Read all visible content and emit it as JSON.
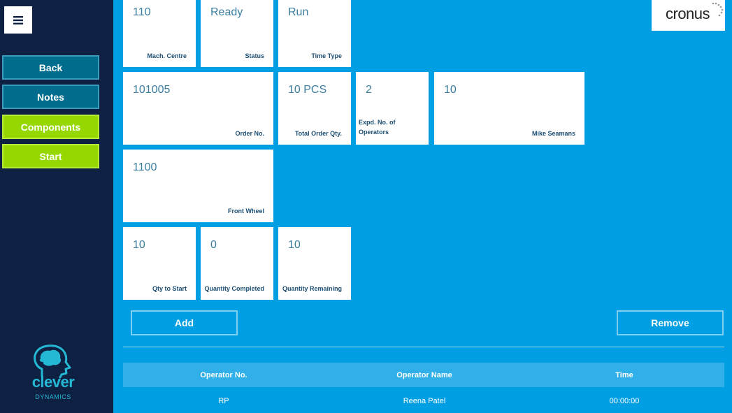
{
  "sidebar": {
    "menu_icon": "hamburger-icon",
    "buttons": [
      {
        "label": "Back",
        "style": "teal"
      },
      {
        "label": "Notes",
        "style": "teal"
      },
      {
        "label": "Components",
        "style": "green"
      },
      {
        "label": "Start",
        "style": "green"
      }
    ],
    "logo": {
      "name": "clever",
      "sub": "DYNAMICS"
    }
  },
  "brand": {
    "name": "cronus"
  },
  "tiles": {
    "mach_centre": {
      "value": "110",
      "label": "Mach. Centre"
    },
    "status": {
      "value": "Ready",
      "label": "Status"
    },
    "time_type": {
      "value": "Run",
      "label": "Time Type"
    },
    "order_no": {
      "value": "101005",
      "label": "Order No."
    },
    "total_order_qty": {
      "value": "10 PCS",
      "label": "Total Order Qty."
    },
    "expd_operators": {
      "value": "2",
      "label": "Expd. No. of Operators"
    },
    "operator_tile": {
      "value": "10",
      "label": "Mike Seamans"
    },
    "item": {
      "value": "1100",
      "label": "Front Wheel"
    },
    "qty_to_start": {
      "value": "10",
      "label": "Qty to Start"
    },
    "qty_completed": {
      "value": "0",
      "label": "Quantity Completed"
    },
    "qty_remaining": {
      "value": "10",
      "label": "Quantity Remaining"
    }
  },
  "actions": {
    "add": "Add",
    "remove": "Remove"
  },
  "operators_table": {
    "headers": [
      "Operator No.",
      "Operator Name",
      "Time"
    ],
    "rows": [
      [
        "RP",
        "Reena Patel",
        "00:00:00"
      ]
    ]
  },
  "colors": {
    "background": "#009fe3",
    "sidebar": "#0e2142",
    "teal_button": "#006c8e",
    "green_button": "#97d700",
    "tile": "#ffffff"
  }
}
